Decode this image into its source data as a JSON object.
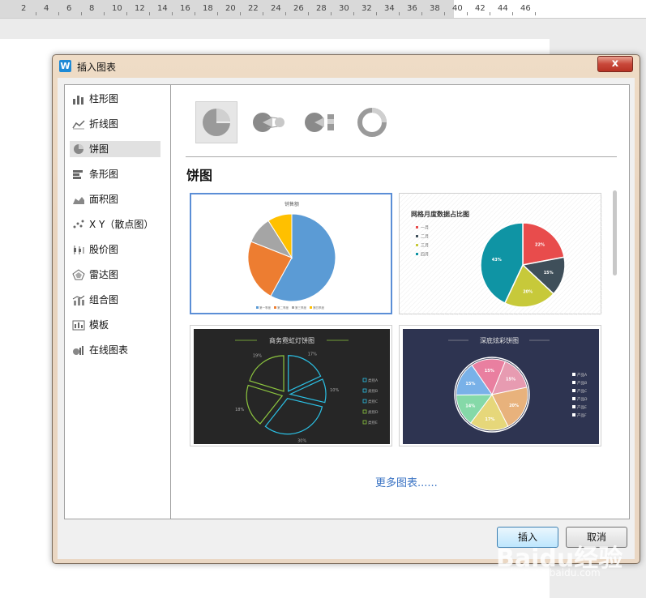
{
  "ruler": {
    "numbers": [
      "2",
      "4",
      "6",
      "8",
      "10",
      "12",
      "14",
      "16",
      "18",
      "20",
      "22",
      "24",
      "26",
      "28",
      "30",
      "32",
      "34",
      "36",
      "38",
      "40",
      "42",
      "44",
      "46"
    ]
  },
  "dialog": {
    "title": "插入图表",
    "close_label": "x",
    "sidebar": {
      "items": [
        {
          "label": "柱形图",
          "icon": "column-chart-icon"
        },
        {
          "label": "折线图",
          "icon": "line-chart-icon"
        },
        {
          "label": "饼图",
          "icon": "pie-chart-icon",
          "selected": true
        },
        {
          "label": "条形图",
          "icon": "bar-chart-icon"
        },
        {
          "label": "面积图",
          "icon": "area-chart-icon"
        },
        {
          "label": "X Y（散点图）",
          "icon": "scatter-chart-icon"
        },
        {
          "label": "股价图",
          "icon": "stock-chart-icon"
        },
        {
          "label": "雷达图",
          "icon": "radar-chart-icon"
        },
        {
          "label": "组合图",
          "icon": "combo-chart-icon"
        },
        {
          "label": "模板",
          "icon": "template-icon"
        },
        {
          "label": "在线图表",
          "icon": "online-chart-icon"
        }
      ]
    },
    "subtypes": [
      "pie",
      "pie-of-pie",
      "bar-of-pie",
      "doughnut"
    ],
    "section_title": "饼图",
    "cards": [
      {
        "title": "销售额",
        "chart_data": {
          "type": "pie",
          "title": "销售额",
          "categories": [
            "第一季度",
            "第二季度",
            "第三季度",
            "第四季度"
          ],
          "values": [
            58,
            23,
            10,
            9
          ],
          "colors": [
            "#5b9bd5",
            "#ed7d31",
            "#a5a5a5",
            "#ffc000"
          ],
          "legend": "bottom"
        }
      },
      {
        "title": "网格月度数据占比图",
        "chart_data": {
          "type": "pie",
          "title": "网格月度数据占比图",
          "categories": [
            "一月",
            "二月",
            "三月",
            "四月"
          ],
          "values": [
            22,
            15,
            20,
            43
          ],
          "labels": [
            "22%",
            "15%",
            "20%",
            "43%"
          ],
          "colors": [
            "#e84c4c",
            "#3f4f5a",
            "#c7c93a",
            "#0f94a4"
          ],
          "legend": "left"
        }
      },
      {
        "title": "商务霓虹灯饼图",
        "chart_data": {
          "type": "pie",
          "title": "商务霓虹灯饼图",
          "categories": [
            "类别A",
            "类别B",
            "类别C",
            "类别D",
            "类别E"
          ],
          "values": [
            17,
            10,
            30,
            18,
            19
          ],
          "labels": [
            "17%",
            "10%",
            "30%",
            "18%",
            "19%"
          ],
          "colors": [
            "#2bc0e4",
            "#2bc0e4",
            "#2bc0e4",
            "#8dc63f",
            "#8dc63f"
          ],
          "legend": "right"
        }
      },
      {
        "title": "深底炫彩饼图",
        "chart_data": {
          "type": "pie",
          "title": "深底炫彩饼图",
          "categories": [
            "产品A",
            "产品B",
            "产品C",
            "产品D",
            "产品E",
            "产品F"
          ],
          "values": [
            15,
            15,
            20,
            17,
            14,
            15
          ],
          "labels": [
            "15%",
            "15%",
            "20%",
            "17%",
            "14%",
            "15%"
          ],
          "colors": [
            "#e97fa0",
            "#e79bb1",
            "#e8b27c",
            "#e6d77a",
            "#85d9a8",
            "#79b1e8"
          ],
          "legend": "right"
        }
      }
    ],
    "more_link": "更多图表......",
    "insert_label": "插入",
    "cancel_label": "取消"
  },
  "watermark": {
    "brand": "Baidu经验",
    "url": "jingyan.baidu.com"
  }
}
